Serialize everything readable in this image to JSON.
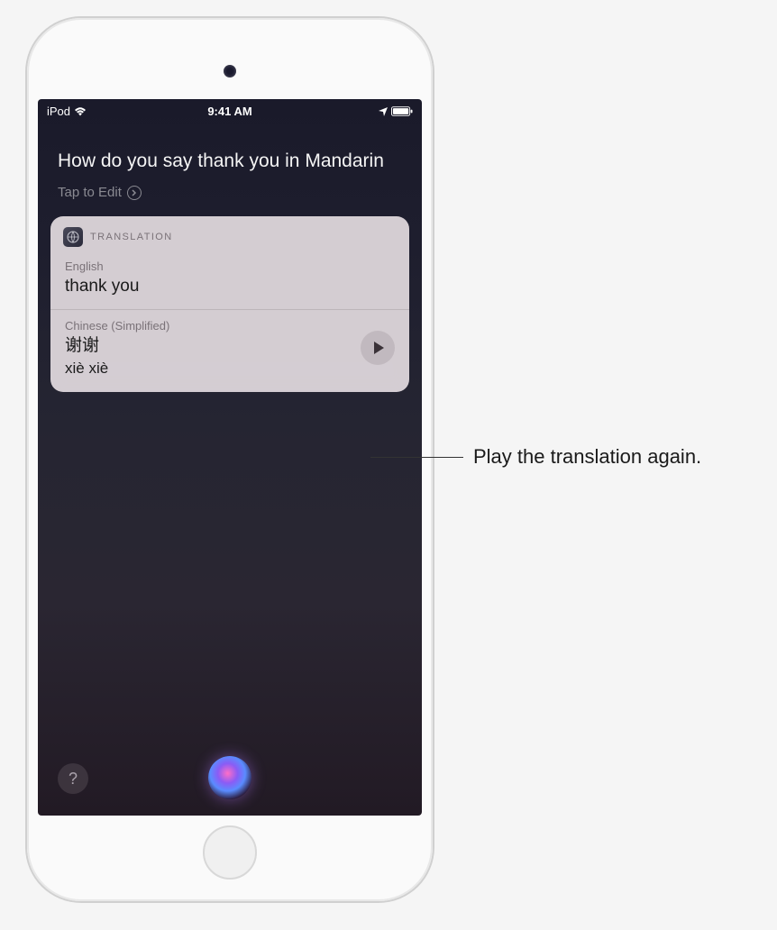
{
  "status_bar": {
    "device": "iPod",
    "time": "9:41 AM"
  },
  "siri": {
    "query": "How do you say thank you in Mandarin",
    "tap_to_edit": "Tap to Edit"
  },
  "translation": {
    "header": "TRANSLATION",
    "source": {
      "language": "English",
      "text": "thank you"
    },
    "target": {
      "language": "Chinese (Simplified)",
      "text": "谢谢",
      "romanization": "xiè xiè"
    }
  },
  "callouts": {
    "play": "Play the translation again."
  },
  "help_button": "?"
}
